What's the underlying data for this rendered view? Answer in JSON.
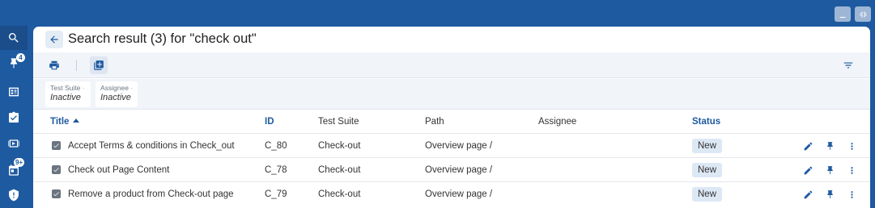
{
  "sidebar": {
    "items": [
      {
        "name": "search-icon",
        "badge": ""
      },
      {
        "name": "pin-icon",
        "badge": "4"
      },
      {
        "name": "dashboard-icon",
        "badge": ""
      },
      {
        "name": "test-case-icon",
        "badge": ""
      },
      {
        "name": "test-run-icon",
        "badge": ""
      },
      {
        "name": "calendar-icon",
        "badge": "9+"
      },
      {
        "name": "shield-icon",
        "badge": ""
      }
    ]
  },
  "window": {
    "controls": [
      "minimize-icon",
      "restore-icon"
    ]
  },
  "header": {
    "title": "Search result (3) for \"check out\""
  },
  "toolbar": {
    "icons": [
      "print-icon",
      "add-to-collection-icon",
      "filter-icon"
    ]
  },
  "filters": [
    {
      "label": "Test Suite",
      "value": "Inactive"
    },
    {
      "label": "Assignee",
      "value": "Inactive"
    }
  ],
  "table": {
    "columns": {
      "title": "Title",
      "id": "ID",
      "test_suite": "Test Suite",
      "path": "Path",
      "assignee": "Assignee",
      "status": "Status"
    },
    "rows": [
      {
        "title": "Accept Terms & conditions in Check_out",
        "id": "C_80",
        "test_suite": "Check-out",
        "path": "Overview page /",
        "assignee": "",
        "status": "New"
      },
      {
        "title": "Check out Page Content",
        "id": "C_78",
        "test_suite": "Check-out",
        "path": "Overview page /",
        "assignee": "",
        "status": "New"
      },
      {
        "title": "Remove a product from Check-out page",
        "id": "C_79",
        "test_suite": "Check-out",
        "path": "Overview page /",
        "assignee": "",
        "status": "New"
      }
    ]
  },
  "colors": {
    "brand": "#1e5aa0",
    "panel": "#ffffff",
    "toolbar": "#f1f4f8",
    "status_bg": "#dde8f5"
  }
}
